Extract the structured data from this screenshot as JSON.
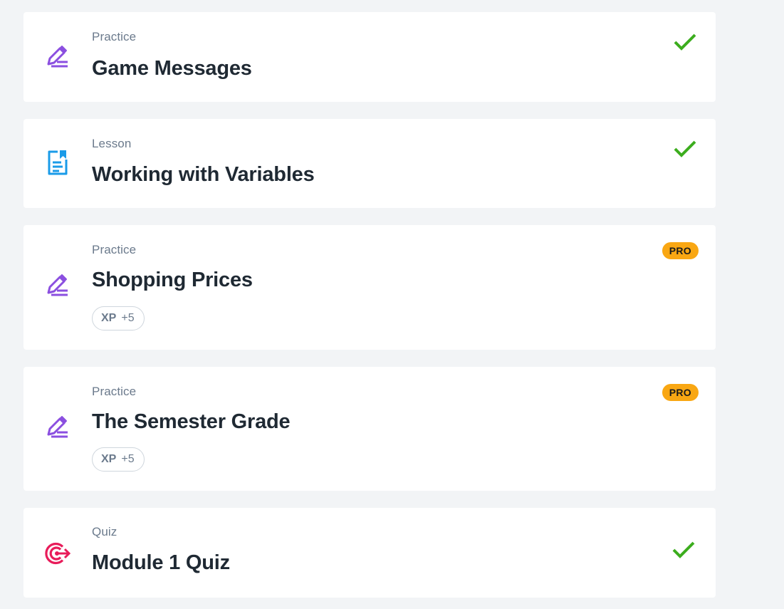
{
  "colors": {
    "background": "#f2f4f6",
    "practice_icon": "#8b4fe0",
    "lesson_icon": "#1a9be8",
    "quiz_icon": "#e81c5a",
    "check": "#3cad1e",
    "pro_badge": "#f9a713"
  },
  "items": [
    {
      "type": "Practice",
      "title": "Game Messages",
      "icon": "pencil-lines-icon",
      "status": "completed"
    },
    {
      "type": "Lesson",
      "title": "Working with Variables",
      "icon": "document-bookmark-icon",
      "status": "completed"
    },
    {
      "type": "Practice",
      "title": "Shopping Prices",
      "icon": "pencil-lines-icon",
      "badge": "PRO",
      "xp_label": "XP",
      "xp_value": "+5"
    },
    {
      "type": "Practice",
      "title": "The Semester Grade",
      "icon": "pencil-lines-icon",
      "badge": "PRO",
      "xp_label": "XP",
      "xp_value": "+5"
    },
    {
      "type": "Quiz",
      "title": "Module 1 Quiz",
      "icon": "target-arrow-icon",
      "status": "completed"
    }
  ]
}
